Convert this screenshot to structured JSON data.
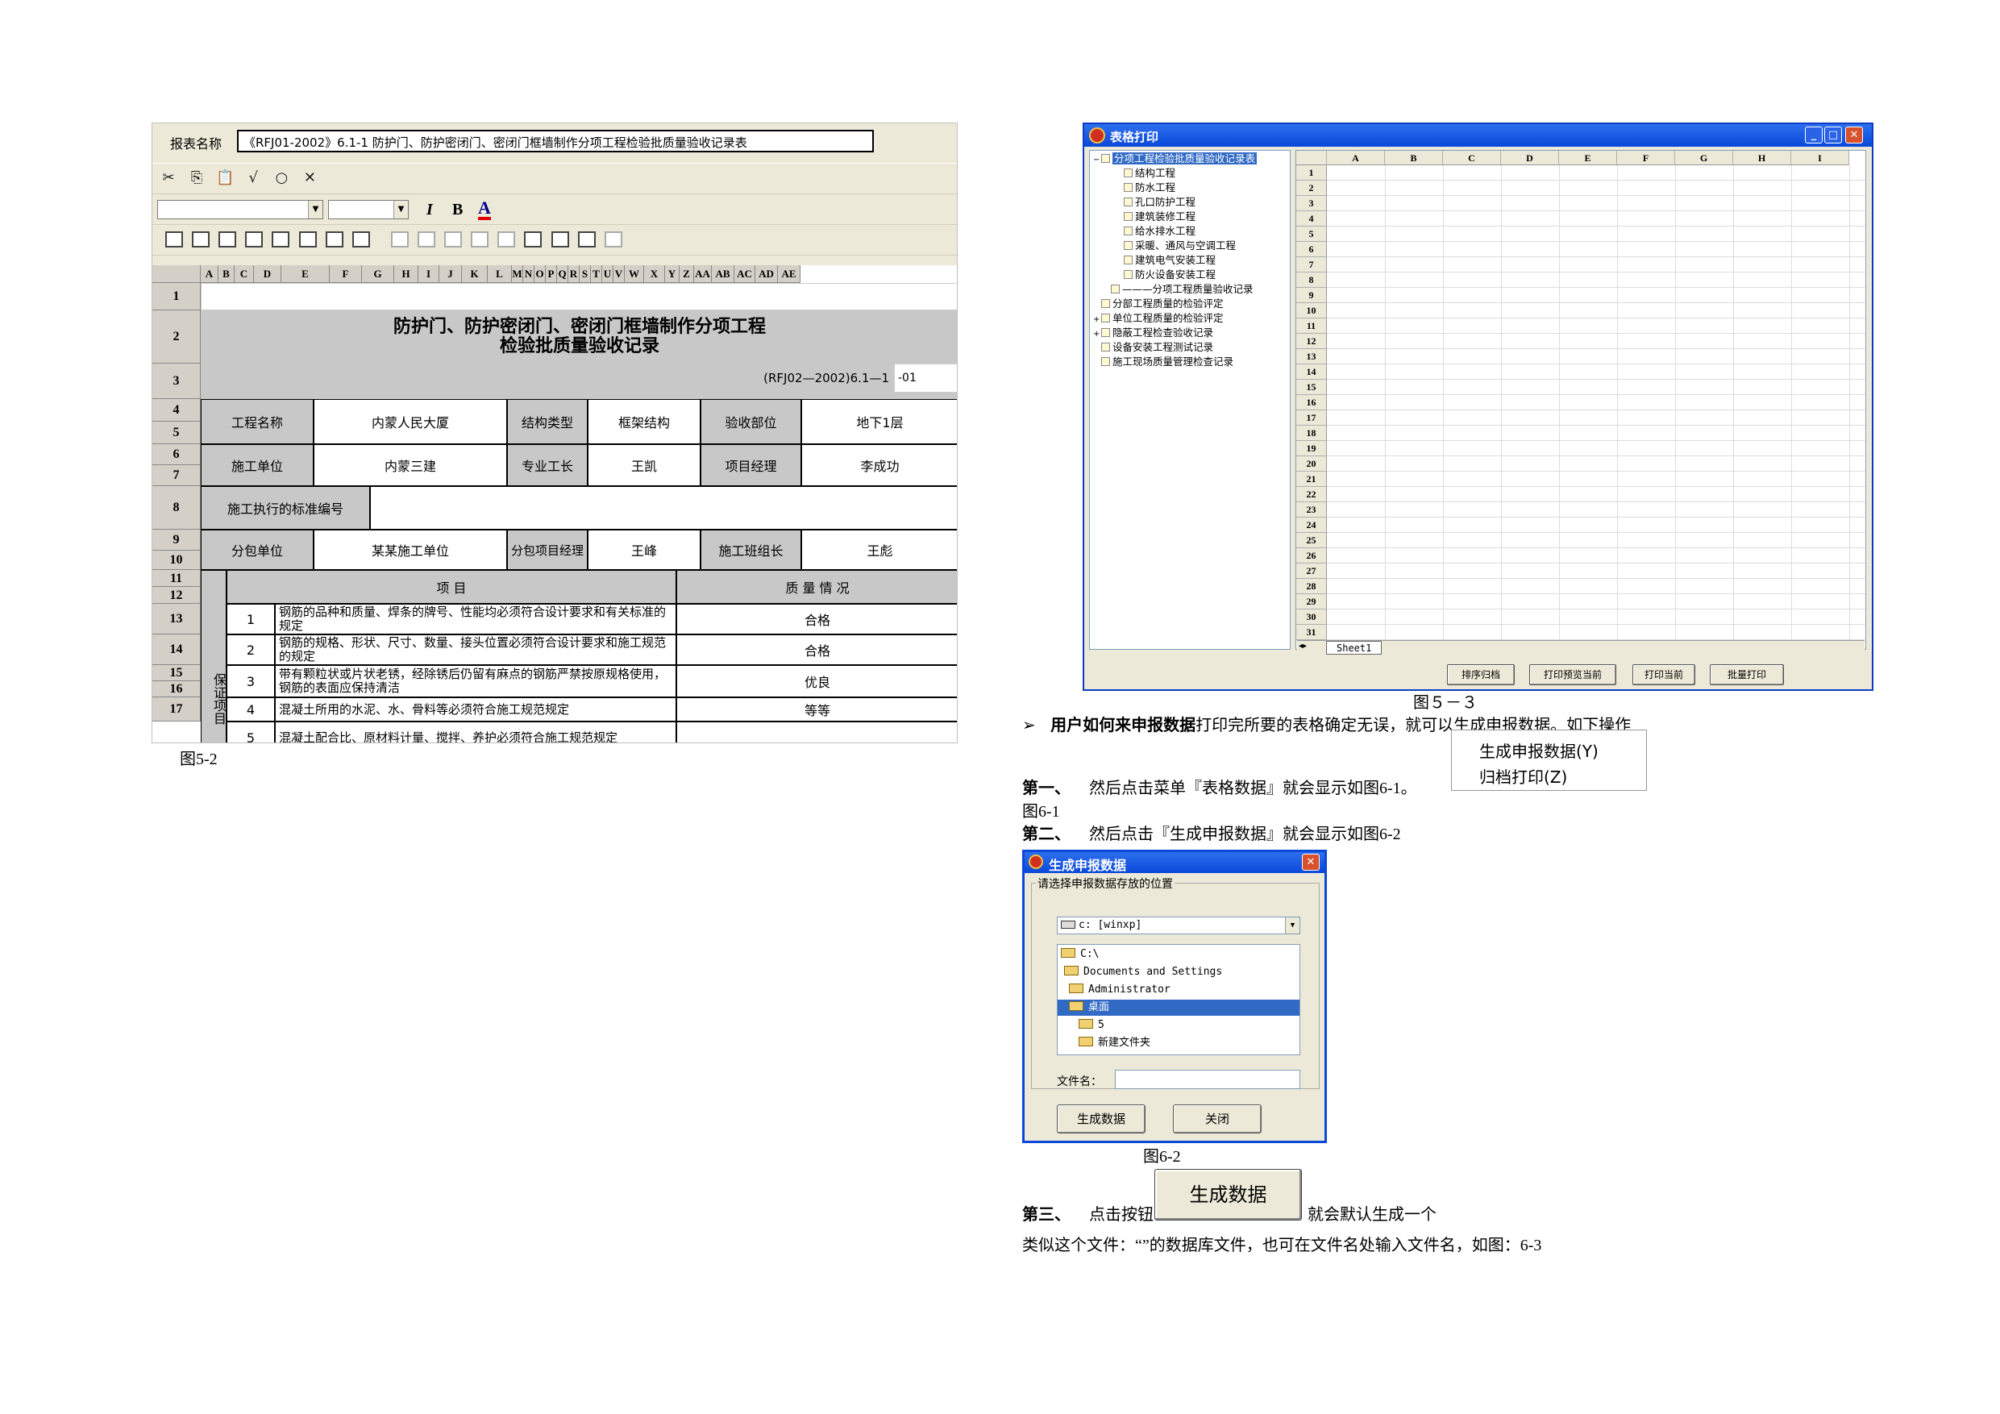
{
  "left_screenshot": {
    "report_label": "报表名称",
    "report_title": "《RFJ01-2002》6.1-1 防护门、防护密闭门、密闭门框墙制作分项工程检验批质量验收记录表",
    "toolbar1_icons": [
      "cut-icon",
      "copy-icon",
      "paste-icon",
      "check-icon",
      "circle-icon",
      "cross-icon"
    ],
    "format_icons": {
      "italic": "I",
      "bold": "B",
      "color": "A"
    },
    "columns": [
      "A",
      "B",
      "C",
      "D",
      "E",
      "F",
      "G",
      "H",
      "I",
      "J",
      "K",
      "L",
      "M",
      "N",
      "O",
      "P",
      "Q",
      "R",
      "S",
      "T",
      "U",
      "V",
      "W",
      "X",
      "Y",
      "Z",
      "AA",
      "AB",
      "AC",
      "AD",
      "AE"
    ],
    "row_numbers": [
      "1",
      "2",
      "3",
      "4",
      "5",
      "6",
      "7",
      "8",
      "9",
      "10",
      "11",
      "12",
      "13",
      "14",
      "15",
      "16",
      "17"
    ],
    "form_title_line1": "防护门、防护密闭门、密闭门框墙制作分项工程",
    "form_title_line2": "检验批质量验收记录",
    "form_code": "(RFJ02—2002)6.1—1",
    "form_code_suffix": "-01",
    "row_a": {
      "l1": "工程名称",
      "v1": "内蒙人民大厦",
      "l2": "结构类型",
      "v2": "框架结构",
      "l3": "验收部位",
      "v3": "地下1层"
    },
    "row_b": {
      "l1": "施工单位",
      "v1": "内蒙三建",
      "l2": "专业工长",
      "v2": "王凯",
      "l3": "项目经理",
      "v3": "李成功"
    },
    "row_c": {
      "l1": "施工执行的标准编号"
    },
    "row_d": {
      "l1": "分包单位",
      "v1": "某某施工单位",
      "l2": "分包项目经理",
      "v2": "王峰",
      "l3": "施工班组长",
      "v3": "王彪"
    },
    "header_item": "项                    目",
    "header_quality": "质     量     情     况",
    "side_label": "保证项目",
    "items": [
      {
        "no": "1",
        "text": "钢筋的品种和质量、焊条的牌号、性能均必须符合设计要求和有关标准的规定",
        "result": "合格"
      },
      {
        "no": "2",
        "text": "钢筋的规格、形状、尺寸、数量、接头位置必须符合设计要求和施工规范的规定",
        "result": "合格"
      },
      {
        "no": "3",
        "text": "带有颗粒状或片状老锈，经除锈后仍留有麻点的钢筋严禁按原规格使用，钢筋的表面应保持清洁",
        "result": "优良"
      },
      {
        "no": "4",
        "text": "混凝土所用的水泥、水、骨料等必须符合施工规范规定",
        "result": "等等"
      },
      {
        "no": "5",
        "text": "混凝土配合比、原材料计量、搅拌、养护必须符合施工规范规定",
        "result": ""
      }
    ]
  },
  "caption_left": "图5-2",
  "window": {
    "title": "表格打印",
    "tree": [
      {
        "label": "分项工程检验批质量验收记录表",
        "level": 0,
        "expander": "−",
        "selected": true
      },
      {
        "label": "结构工程",
        "level": 2
      },
      {
        "label": "防水工程",
        "level": 2
      },
      {
        "label": "孔口防护工程",
        "level": 2
      },
      {
        "label": "建筑装修工程",
        "level": 2
      },
      {
        "label": "给水排水工程",
        "level": 2
      },
      {
        "label": "采暖、通风与空调工程",
        "level": 2
      },
      {
        "label": "建筑电气安装工程",
        "level": 2
      },
      {
        "label": "防火设备安装工程",
        "level": 2
      },
      {
        "label": "———分项工程质量验收记录",
        "level": 1
      },
      {
        "label": "分部工程质量的检验评定",
        "level": 0
      },
      {
        "label": "单位工程质量的检验评定",
        "level": 0,
        "expander": "+"
      },
      {
        "label": "隐蔽工程检查验收记录",
        "level": 0,
        "expander": "+"
      },
      {
        "label": "设备安装工程测试记录",
        "level": 0
      },
      {
        "label": "施工现场质量管理检查记录",
        "level": 0
      }
    ],
    "grid_columns": [
      "A",
      "B",
      "C",
      "D",
      "E",
      "F",
      "G",
      "H",
      "I"
    ],
    "grid_rows": [
      "1",
      "2",
      "3",
      "4",
      "5",
      "6",
      "7",
      "8",
      "9",
      "10",
      "11",
      "12",
      "13",
      "14",
      "15",
      "16",
      "17",
      "18",
      "19",
      "20",
      "21",
      "22",
      "23",
      "24",
      "25",
      "26",
      "27",
      "28",
      "29",
      "30",
      "31"
    ],
    "sheet_tab": "Sheet1",
    "buttons": [
      "排序归档",
      "打印预览当前",
      "打印当前",
      "批量打印"
    ]
  },
  "caption_window": "图５－３",
  "bullet_symbol": "➢",
  "para1_bold": "用户如何来申报数据",
  "para1_rest": "打印完所要的表格确定无误，就可以生成申报数据。如下操作",
  "menu_items": [
    "生成申报数据(Y)",
    "归档打印(Z)"
  ],
  "step1_label": "第一、",
  "step1_text": "然后点击菜单『表格数据』就会显示如图6-1。",
  "fig61": "图6-1",
  "step2_label": "第二、",
  "step2_text": "然后点击『生成申报数据』就会显示如图6-2",
  "dialog": {
    "title": "生成申报数据",
    "group_label": "请选择申报数据存放的位置",
    "drive": "c: [winxp]",
    "folders": [
      "C:\\",
      "Documents and Settings",
      "Administrator",
      "桌面",
      "5",
      "新建文件夹"
    ],
    "filename_label": "文件名：",
    "filename_value": "",
    "btn_generate": "生成数据",
    "btn_close": "关闭"
  },
  "fig62": "图6-2",
  "big_button": "生成数据",
  "step3_label": "第三、",
  "step3_pre": "点击按钮",
  "step3_post": "就会默认生成一个",
  "last_line": "类似这个文件：“”的数据库文件，也可在文件名处输入文件名，如图：6-3"
}
